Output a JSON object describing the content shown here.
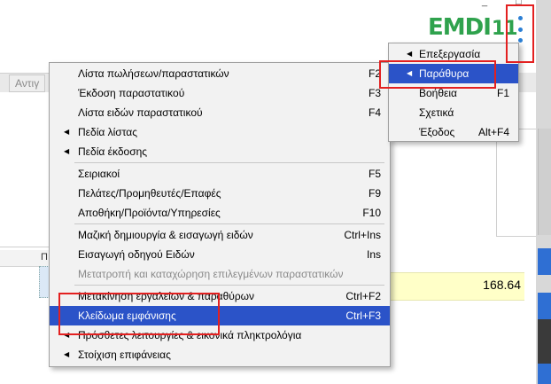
{
  "app": {
    "logo_text": "EMDI",
    "logo_number": "11",
    "window_controls": [
      "_",
      "□"
    ],
    "background_tab_label": "Αντιγ",
    "grid_header_char": "Π",
    "amount_value": "168.64",
    "colors": {
      "accent": "#2b53c8",
      "logo": "#2fa24d",
      "kebab": "#2b7fd4",
      "highlight": "#e32020",
      "row_bg": "#ffffc8"
    }
  },
  "kebab": {
    "icon": "vertical-dots-icon"
  },
  "submenu": {
    "items": [
      {
        "label": "Επεξεργασία",
        "has_submenu": true,
        "shortcut": ""
      },
      {
        "label": "Παράθυρα",
        "has_submenu": true,
        "shortcut": "",
        "selected": true
      },
      {
        "label": "Βοήθεια",
        "has_submenu": false,
        "shortcut": "F1"
      },
      {
        "label": "Σχετικά",
        "has_submenu": false,
        "shortcut": ""
      },
      {
        "label": "Έξοδος",
        "has_submenu": false,
        "shortcut": "Alt+F4"
      }
    ]
  },
  "menu": {
    "items": [
      {
        "label": "Λίστα πωλήσεων/παραστατικών",
        "shortcut": "F2"
      },
      {
        "label": "Έκδοση παραστατικού",
        "shortcut": "F3"
      },
      {
        "label": "Λίστα ειδών παραστατικού",
        "shortcut": "F4"
      },
      {
        "label": "Πεδία λίστας",
        "shortcut": "",
        "has_submenu": true
      },
      {
        "label": "Πεδία έκδοσης",
        "shortcut": "",
        "has_submenu": true
      },
      {
        "label": "Σειριακοί",
        "shortcut": "F5"
      },
      {
        "label": "Πελάτες/Προμηθευτές/Επαφές",
        "shortcut": "F9"
      },
      {
        "label": "Αποθήκη/Προϊόντα/Υπηρεσίες",
        "shortcut": "F10"
      },
      {
        "label": "Μαζική δημιουργία & εισαγωγή ειδών",
        "shortcut": "Ctrl+Ins"
      },
      {
        "label": "Εισαγωγή οδηγού Ειδών",
        "shortcut": "Ins"
      },
      {
        "label": "Μετατροπή και καταχώρηση επιλεγμένων παραστατικών",
        "shortcut": "",
        "disabled": true
      },
      {
        "label": "Μετακίνηση εργαλείων & παραθύρων",
        "shortcut": "Ctrl+F2"
      },
      {
        "label": "Κλείδωμα εμφάνισης",
        "shortcut": "Ctrl+F3",
        "selected": true
      },
      {
        "label": "Πρόσθετες λειτουργίες & εικονικά πληκτρολόγια",
        "shortcut": "",
        "has_submenu": true
      },
      {
        "label": "Στοίχιση επιφάνειας",
        "shortcut": "",
        "has_submenu": true
      }
    ]
  }
}
